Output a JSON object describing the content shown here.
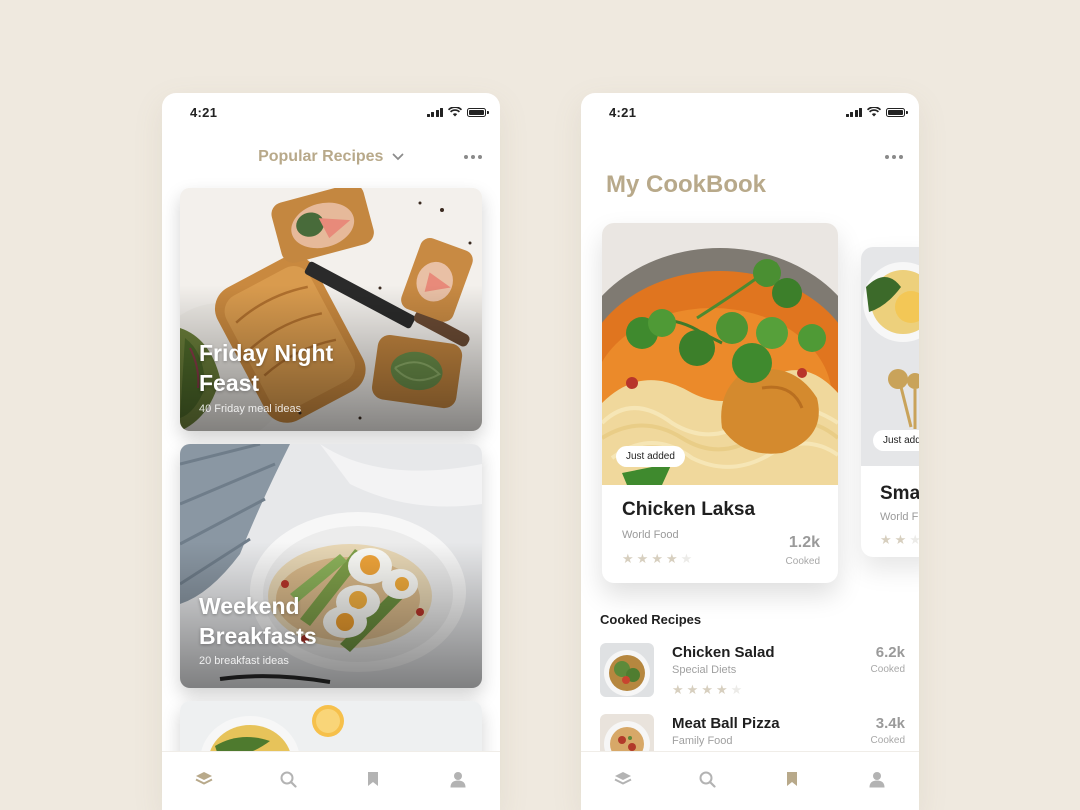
{
  "colors": {
    "background": "#efe9df",
    "accent": "#b8a98a",
    "star_on": "#d7cfbf",
    "star_off": "#ecebe8",
    "tab_active": "#b8a98a",
    "tab_inactive": "#b3b3b3"
  },
  "left_screen": {
    "status": {
      "time": "4:21"
    },
    "header": {
      "title": "Popular Recipes",
      "dropdown_icon": "chevron-down-icon",
      "menu_icon": "more-dots-icon"
    },
    "cards": [
      {
        "title": "Friday Night Feast",
        "subtitle": "40 Friday meal ideas"
      },
      {
        "title": "Weekend Breakfasts",
        "subtitle": "20 breakfast ideas"
      }
    ],
    "tab_bar": {
      "active": "layers-icon",
      "tabs": [
        "layers-icon",
        "search-icon",
        "bookmark-icon",
        "profile-icon"
      ]
    }
  },
  "right_screen": {
    "status": {
      "time": "4:21"
    },
    "page_title": "My CookBook",
    "cookbook_cards": [
      {
        "badge": "Just added",
        "name": "Chicken Laksa",
        "category": "World Food",
        "rating": 4,
        "count": "1.2k",
        "count_label": "Cooked"
      },
      {
        "badge": "Just adde",
        "name": "Sma",
        "category": "World F",
        "rating": 2
      }
    ],
    "cooked_section": {
      "title": "Cooked Recipes",
      "items": [
        {
          "name": "Chicken Salad",
          "category": "Special Diets",
          "rating": 4,
          "count": "6.2k",
          "count_label": "Cooked"
        },
        {
          "name": "Meat Ball Pizza",
          "category": "Family Food",
          "count": "3.4k",
          "count_label": "Cooked"
        }
      ]
    },
    "tab_bar": {
      "active": "bookmark-icon",
      "tabs": [
        "layers-icon",
        "search-icon",
        "bookmark-icon",
        "profile-icon"
      ]
    }
  }
}
